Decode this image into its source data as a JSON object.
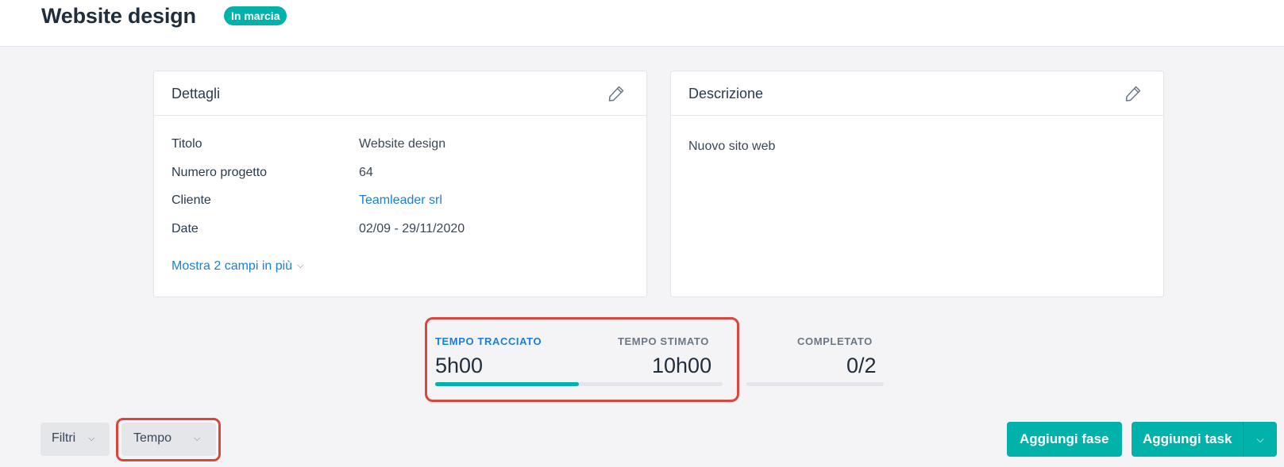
{
  "header": {
    "title": "Website design",
    "status_badge": "In marcia",
    "status_color": "#00b2a9"
  },
  "details_card": {
    "title": "Dettagli",
    "edit_icon": "pencil-icon",
    "rows": [
      {
        "label": "Titolo",
        "value": "Website design"
      },
      {
        "label": "Numero progetto",
        "value": "64"
      },
      {
        "label": "Cliente",
        "value": "Teamleader srl"
      },
      {
        "label": "Date",
        "value": "02/09 - 29/11/2020"
      }
    ],
    "show_more": "Mostra 2 campi in più"
  },
  "description_card": {
    "title": "Descrizione",
    "edit_icon": "pencil-icon",
    "text": "Nuovo sito web"
  },
  "stats": {
    "tracked_label": "TEMPO TRACCIATO",
    "tracked_value": "5h00",
    "estimated_label": "TEMPO STIMATO",
    "estimated_value": "10h00",
    "time_progress": 0.5,
    "completed_label": "COMPLETATO",
    "completed_value": "0/2",
    "completed_progress": 0
  },
  "toolbar": {
    "filters_label": "Filtri",
    "tempo_label": "Tempo",
    "add_phase_label": "Aggiungi fase",
    "add_task_label": "Aggiungi task"
  },
  "colors": {
    "accent": "#00b2a9",
    "link": "#1a7fdc",
    "highlight": "#d9463b"
  }
}
